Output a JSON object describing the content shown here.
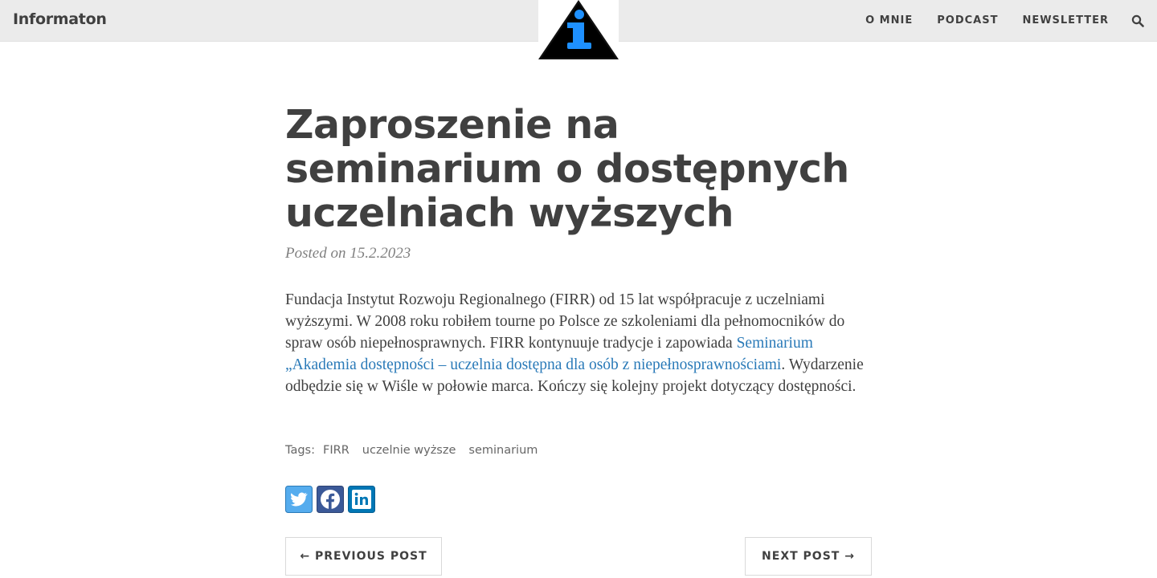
{
  "navbar": {
    "brand": "Informaton",
    "links": [
      "O MNIE",
      "PODCAST",
      "NEWSLETTER"
    ],
    "search_icon": "search-icon",
    "logo": "info-triangle-logo"
  },
  "post": {
    "title": "Zaproszenie na seminarium o dostępnych uczelniach wyższych",
    "meta": "Posted on 15.2.2023",
    "body_before_link": "Fundacja Instytut Rozwoju Regionalnego (FIRR) od 15 lat współpracuje z uczelniami wyższymi. W 2008 roku robiłem tourne po Polsce ze szkoleniami dla pełnomocników do spraw osób niepełnosprawnych. FIRR kontynuuje tradycje i zapowiada ",
    "body_link": "Seminarium „Akademia dostępności – uczelnia dostępna dla osób z niepełnosprawnościami",
    "body_after_link": ". Wydarzenie odbędzie się w Wiśle w połowie marca. Kończy się kolejny projekt dotyczący dostępności."
  },
  "tags": {
    "label": "Tags:",
    "items": [
      "FIRR",
      "uczelnie wyższe",
      "seminarium"
    ]
  },
  "share": {
    "icons": [
      "twitter-icon",
      "facebook-icon",
      "linkedin-icon"
    ]
  },
  "pager": {
    "previous": "← PREVIOUS POST",
    "next": "NEXT POST →"
  },
  "colors": {
    "navbar_bg": "#ebebeb",
    "text": "#404040",
    "link": "#2a7ab8",
    "logo_accent": "#1e90ff",
    "twitter": "#55acee",
    "facebook": "#3b5998",
    "linkedin": "#0077b5"
  }
}
